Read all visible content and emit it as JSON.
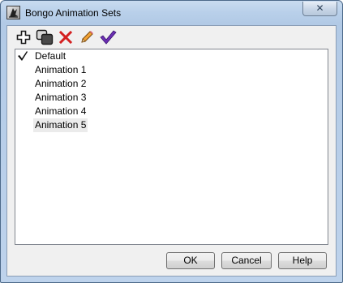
{
  "window": {
    "title": "Bongo Animation Sets",
    "close_label": "✕"
  },
  "toolbar": {
    "tools": [
      {
        "name": "add",
        "icon": "plus-icon"
      },
      {
        "name": "duplicate",
        "icon": "duplicate-icon"
      },
      {
        "name": "delete",
        "icon": "delete-x-icon",
        "color": "#d42020"
      },
      {
        "name": "rename",
        "icon": "pencil-icon",
        "color": "#e88a1a"
      },
      {
        "name": "activate",
        "icon": "checkmark-icon",
        "color": "#6b2fb3"
      }
    ]
  },
  "list": {
    "items": [
      {
        "label": "Default",
        "active": true
      },
      {
        "label": "Animation 1"
      },
      {
        "label": "Animation 2"
      },
      {
        "label": "Animation 3"
      },
      {
        "label": "Animation 4"
      },
      {
        "label": "Animation 5",
        "selected": true
      }
    ]
  },
  "buttons": {
    "ok_label": "OK",
    "cancel_label": "Cancel",
    "help_label": "Help"
  }
}
